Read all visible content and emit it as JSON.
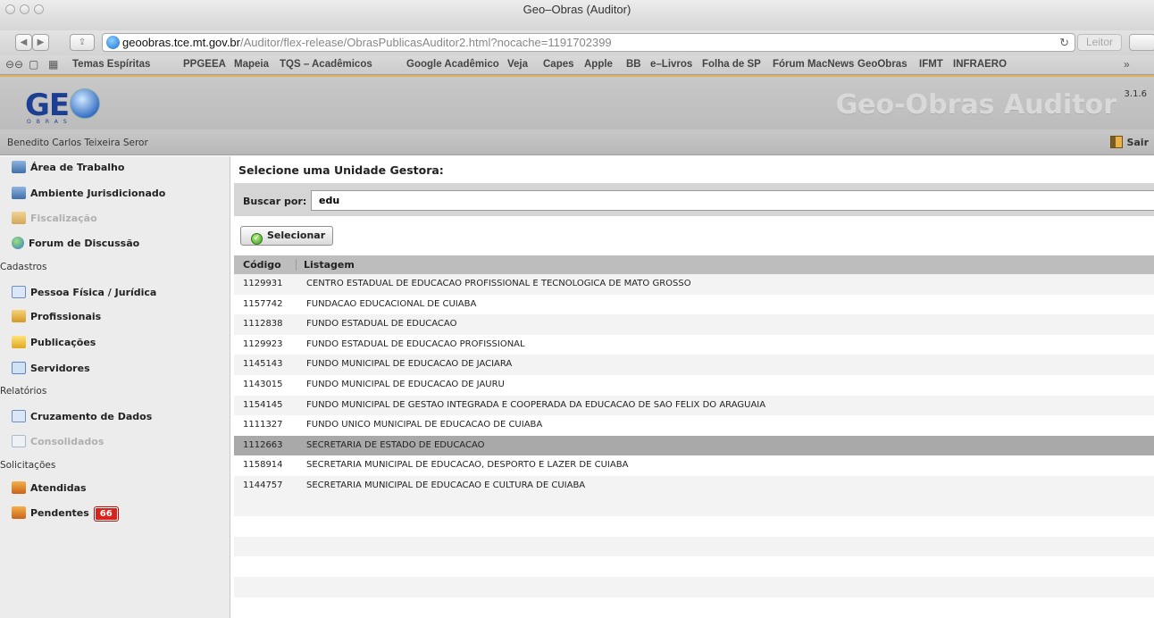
{
  "browser": {
    "window_title": "Geo–Obras (Auditor)",
    "url_host": "geoobras.tce.mt.gov.br",
    "url_path": "/Auditor/flex-release/ObrasPublicasAuditor2.html?nocache=1191702399",
    "reader_label": "Leitor",
    "bookmarks": [
      "Temas Espíritas",
      "PPGEEA",
      "Mapeia",
      "TQS – Acadêmicos",
      "Google Acadêmico",
      "Veja",
      "Capes",
      "Apple",
      "BB",
      "e–Livros",
      "Folha de SP",
      "Fórum MacNews",
      "GeoObras",
      "IFMT",
      "INFRAERO"
    ],
    "more_label": "»"
  },
  "header": {
    "logo_text": "GE",
    "logo_subtext": "OBRAS",
    "app_name": "Geo-Obras Auditor",
    "version": "3.1.6"
  },
  "userbar": {
    "user_name": "Benedito Carlos Teixeira Seror",
    "logout_label": "Sair"
  },
  "sidebar": {
    "items": [
      {
        "label": "Área de Trabalho",
        "icon": "users-icon",
        "disabled": false
      },
      {
        "label": "Ambiente Jurisdicionado",
        "icon": "users-icon",
        "disabled": false
      },
      {
        "label": "Fiscalização",
        "icon": "inspector-icon",
        "disabled": true
      },
      {
        "label": "Forum de Discussão",
        "icon": "globe-icon",
        "disabled": false
      }
    ],
    "section_cadastros": "Cadastros",
    "cadastros": [
      {
        "label": "Pessoa Física / Jurídica",
        "icon": "form-icon"
      },
      {
        "label": "Profissionais",
        "icon": "professional-icon"
      },
      {
        "label": "Publicações",
        "icon": "folder-icon"
      },
      {
        "label": "Servidores",
        "icon": "table-icon"
      }
    ],
    "section_relatorios": "Relatórios",
    "relatorios": [
      {
        "label": "Cruzamento de Dados",
        "icon": "form-icon",
        "disabled": false
      },
      {
        "label": "Consolidados",
        "icon": "form-icon",
        "disabled": true
      }
    ],
    "section_solicitacoes": "Solicitações",
    "solicitacoes": [
      {
        "label": "Atendidas",
        "icon": "inbox-icon"
      },
      {
        "label": "Pendentes",
        "icon": "inbox-icon",
        "badge": "66"
      }
    ]
  },
  "main": {
    "title": "Selecione uma Unidade Gestora:",
    "search_label": "Buscar por:",
    "search_value": "edu",
    "select_button": "Selecionar",
    "columns": [
      "Código",
      "Listagem"
    ],
    "rows": [
      {
        "code": "1129931",
        "name": "CENTRO ESTADUAL DE EDUCACAO PROFISSIONAL E TECNOLOGICA DE MATO GROSSO"
      },
      {
        "code": "1157742",
        "name": "FUNDACAO EDUCACIONAL DE CUIABA"
      },
      {
        "code": "1112838",
        "name": "FUNDO ESTADUAL DE EDUCACAO"
      },
      {
        "code": "1129923",
        "name": "FUNDO ESTADUAL DE EDUCACAO PROFISSIONAL"
      },
      {
        "code": "1145143",
        "name": "FUNDO MUNICIPAL DE EDUCACAO DE JACIARA"
      },
      {
        "code": "1143015",
        "name": "FUNDO MUNICIPAL DE EDUCACAO DE JAURU"
      },
      {
        "code": "1154145",
        "name": "FUNDO MUNICIPAL DE GESTAO INTEGRADA E COOPERADA DA EDUCACAO DE SAO FELIX DO ARAGUAIA"
      },
      {
        "code": "1111327",
        "name": "FUNDO UNICO MUNICIPAL DE EDUCACAO DE CUIABA"
      },
      {
        "code": "1112663",
        "name": "SECRETARIA DE ESTADO DE EDUCACAO"
      },
      {
        "code": "1158914",
        "name": "SECRETARIA MUNICIPAL DE EDUCACAO, DESPORTO E LAZER DE CUIABA"
      },
      {
        "code": "1144757",
        "name": "SECRETARIA MUNICIPAL DE EDUCACAO E CULTURA DE CUIABA"
      }
    ],
    "selected_index": 8
  }
}
